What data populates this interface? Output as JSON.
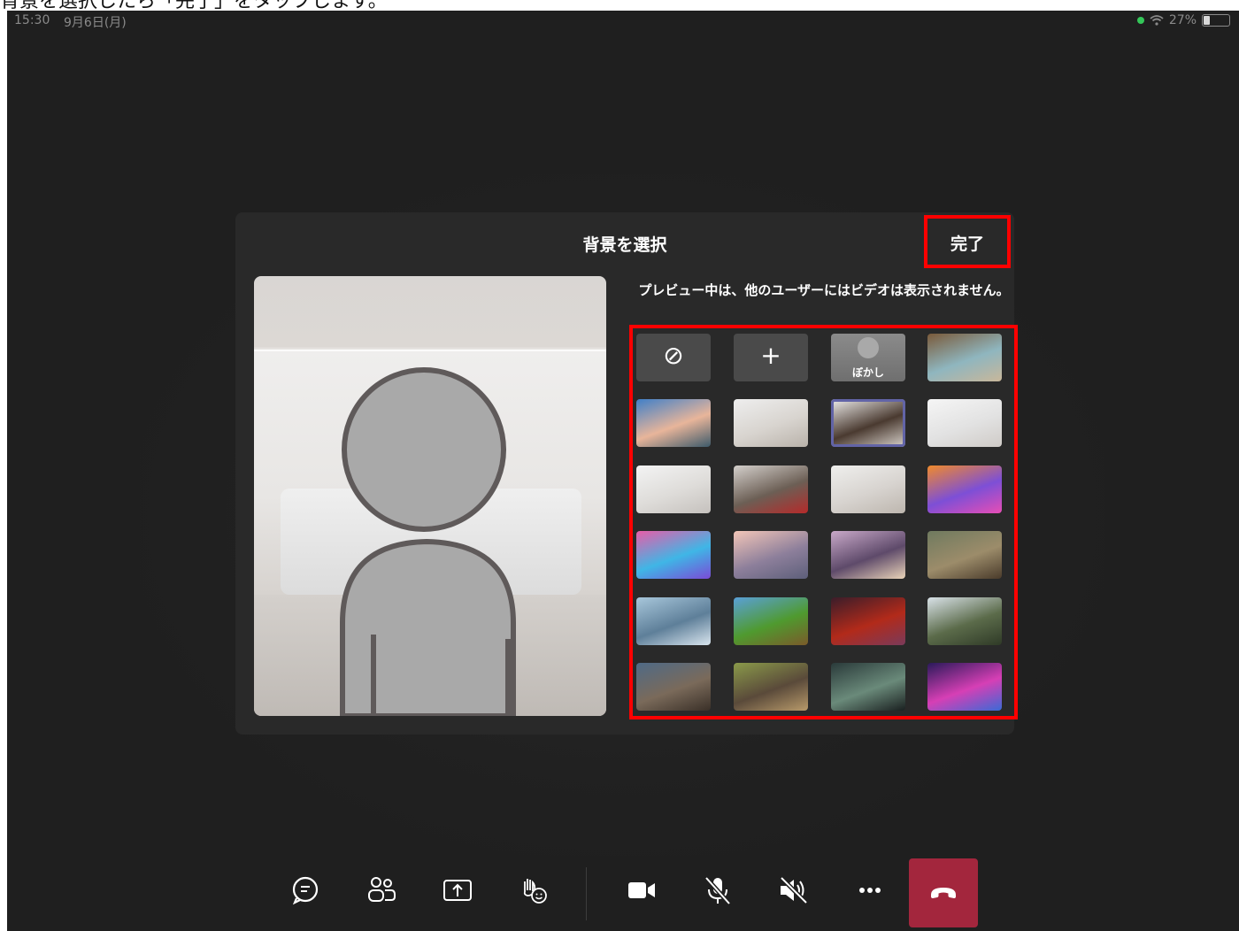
{
  "caption": "背景を選択したら「完了」をタップします。",
  "statusbar": {
    "time": "15:30",
    "date": "9月6日(月)",
    "battery": "27%"
  },
  "panel": {
    "title": "背景を選択",
    "done_label": "完了",
    "notice": "プレビュー中は、他のユーザーにはビデオは表示されません。"
  },
  "background_options": [
    {
      "name": "none",
      "kind": "icon",
      "glyph": "⊘"
    },
    {
      "name": "add",
      "kind": "icon",
      "glyph": "+"
    },
    {
      "name": "blur",
      "kind": "blur",
      "label": "ぼかし"
    },
    {
      "name": "office-glass",
      "colors": [
        "#7a5a3a",
        "#8fb6bf",
        "#c9b79a"
      ]
    },
    {
      "name": "street-sky",
      "colors": [
        "#3f7fc8",
        "#e8b59a",
        "#3d5a6a"
      ]
    },
    {
      "name": "white-room-1",
      "colors": [
        "#eeeeee",
        "#d8d4cf",
        "#b9b2aa"
      ]
    },
    {
      "name": "white-room-window",
      "colors": [
        "#f0efee",
        "#4a3a30",
        "#d9d3cd"
      ]
    },
    {
      "name": "white-room-2",
      "colors": [
        "#f5f5f5",
        "#e2e2e2",
        "#cfcbc7"
      ]
    },
    {
      "name": "white-room-3",
      "colors": [
        "#f3f3f3",
        "#dedcd9",
        "#c5c1bd"
      ]
    },
    {
      "name": "office-interior",
      "colors": [
        "#d4d0cc",
        "#6c5f55",
        "#b52a2a"
      ]
    },
    {
      "name": "white-curtain",
      "colors": [
        "#efefed",
        "#d7d3cf",
        "#bdb6ae"
      ]
    },
    {
      "name": "balloons-orange",
      "colors": [
        "#f08a2b",
        "#7d4fd6",
        "#e74eb5"
      ]
    },
    {
      "name": "balloons-pink",
      "colors": [
        "#e95da8",
        "#3fb6e6",
        "#7a4bd6"
      ]
    },
    {
      "name": "bridge",
      "colors": [
        "#f3c6b8",
        "#8d7f9b",
        "#5d5f7a"
      ]
    },
    {
      "name": "canyon-creature",
      "colors": [
        "#c9a9c9",
        "#5e4a6a",
        "#e9d3b8"
      ]
    },
    {
      "name": "classroom",
      "colors": [
        "#6f7a5f",
        "#9c8c6a",
        "#4a3b2b"
      ]
    },
    {
      "name": "lab",
      "colors": [
        "#a8c7db",
        "#5e7f99",
        "#d9e5ee"
      ]
    },
    {
      "name": "minecraft-grass",
      "colors": [
        "#5aa0d8",
        "#4f9a2f",
        "#7a5a2a"
      ]
    },
    {
      "name": "minecraft-nether",
      "colors": [
        "#3a1d2a",
        "#b22a1a",
        "#7a3a5a"
      ]
    },
    {
      "name": "mountain-valley",
      "colors": [
        "#d9e2e8",
        "#5b6b4a",
        "#2f3a27"
      ]
    },
    {
      "name": "ruins-arch",
      "colors": [
        "#4f6a86",
        "#7a6a5a",
        "#3a3028"
      ]
    },
    {
      "name": "village-street",
      "colors": [
        "#8a9a4a",
        "#5a4a3a",
        "#b89a6a"
      ]
    },
    {
      "name": "alien-planet",
      "colors": [
        "#2a3a3a",
        "#6a8a7a",
        "#1a2020"
      ]
    },
    {
      "name": "galaxy",
      "colors": [
        "#2a1a5a",
        "#d63fb5",
        "#3a6ad6"
      ]
    }
  ],
  "selected_background": "white-room-window",
  "toolbar": [
    {
      "name": "chat-icon"
    },
    {
      "name": "participants-icon"
    },
    {
      "name": "share-icon"
    },
    {
      "name": "reactions-icon"
    },
    {
      "name": "camera-icon"
    },
    {
      "name": "mic-off-icon"
    },
    {
      "name": "speaker-off-icon"
    },
    {
      "name": "more-icon"
    }
  ],
  "colors": {
    "highlight": "#ff0000",
    "hangup": "#a3263d",
    "accent": "#6264a7"
  }
}
